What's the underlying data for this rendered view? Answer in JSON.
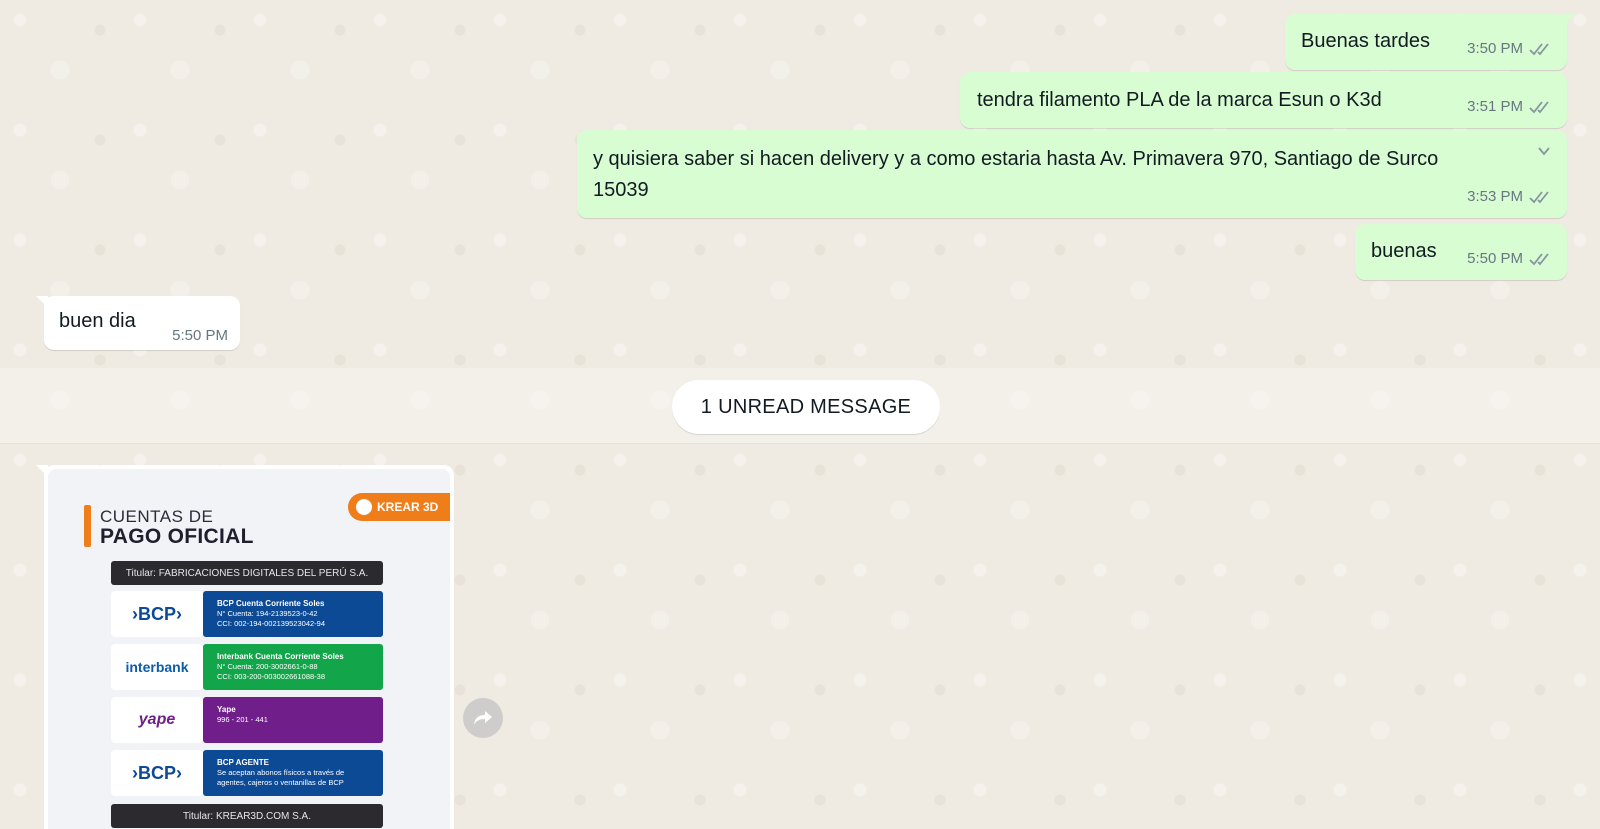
{
  "messages_outgoing": [
    {
      "text": "Buenas tardes",
      "time": "3:50 PM"
    },
    {
      "text": "tendra filamento PLA de la marca Esun o K3d",
      "time": "3:51 PM"
    },
    {
      "text": "y quisiera saber si hacen delivery y a como estaria hasta Av. Primavera 970, Santiago de Surco 15039",
      "time": "3:53 PM"
    },
    {
      "text": "buenas",
      "time": "5:50 PM"
    }
  ],
  "messages_incoming": [
    {
      "text": "buen dia",
      "time": "5:50 PM"
    }
  ],
  "unread": {
    "label": "1 UNREAD MESSAGE"
  },
  "image_message": {
    "title_line1": "CUENTAS DE",
    "title_line2": "PAGO OFICIAL",
    "brand": "KREAR 3D",
    "titular_1": "Titular: FABRICACIONES DIGITALES DEL PERÚ S.A.",
    "titular_2": "Titular: KREAR3D.COM S.A.",
    "banks": [
      {
        "logo": "›BCP›",
        "title": "BCP Cuenta Corriente Soles",
        "line1": "N° Cuenta: 194-2139523-0-42",
        "line2": "CCI: 002-194-002139523042-94",
        "color": "#0d4a96",
        "logo_color": "#0d4a96"
      },
      {
        "logo": "interbank",
        "title": "Interbank Cuenta Corriente Soles",
        "line1": "N° Cuenta: 200-3002661-0-88",
        "line2": "CCI: 003-200-003002661088-38",
        "color": "#13a54a",
        "logo_color": "#0b5cab"
      },
      {
        "logo": "yape",
        "title": "Yape",
        "line1": "996 - 201 - 441",
        "line2": "",
        "color": "#6f1e8a",
        "logo_color": "#6f1e8a"
      },
      {
        "logo": "›BCP›",
        "title": "BCP AGENTE",
        "line1": "Se aceptan abonos físicos a través de",
        "line2": "agentes, cajeros o ventanillas de BCP",
        "color": "#0d4a96",
        "logo_color": "#0d4a96"
      }
    ]
  },
  "icons": {
    "ticks": "double-check-icon",
    "chevron": "chevron-down-icon",
    "forward": "forward-icon"
  },
  "colors": {
    "outgoing_bubble": "#d9fdd3",
    "incoming_bubble": "#ffffff",
    "chat_bg": "#efeae2",
    "tick": "#8696a0"
  }
}
